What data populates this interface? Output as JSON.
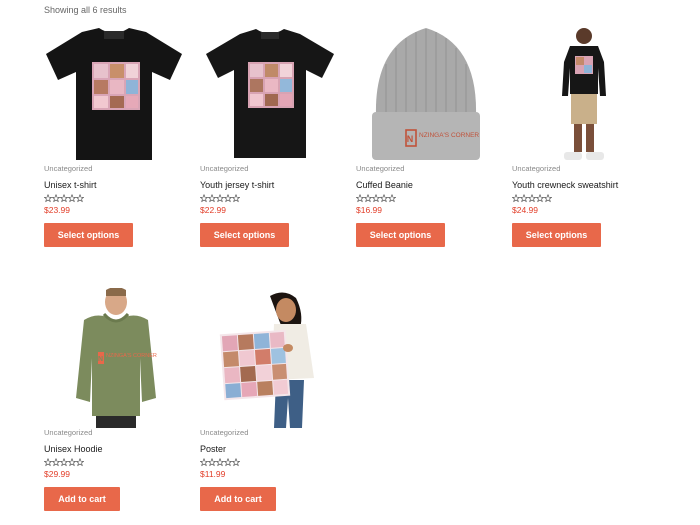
{
  "result_count": "Showing all 6 results",
  "colors": {
    "accent": "#e8684a",
    "price": "#e23d28"
  },
  "products": [
    {
      "category": "Uncategorized",
      "title": "Unisex t-shirt",
      "price": "$23.99",
      "button": "Select options",
      "rating": 0,
      "image": "black-tshirt-icon"
    },
    {
      "category": "Uncategorized",
      "title": "Youth jersey t-shirt",
      "price": "$22.99",
      "button": "Select options",
      "rating": 0,
      "image": "black-youth-tshirt-icon"
    },
    {
      "category": "Uncategorized",
      "title": "Cuffed Beanie",
      "price": "$16.99",
      "button": "Select options",
      "rating": 0,
      "image": "grey-beanie-icon",
      "logo_text": "NZINGA'S CORNER"
    },
    {
      "category": "Uncategorized",
      "title": "Youth crewneck sweatshirt",
      "price": "$24.99",
      "button": "Select options",
      "rating": 0,
      "image": "boy-sweatshirt-icon"
    },
    {
      "category": "Uncategorized",
      "title": "Unisex Hoodie",
      "price": "$29.99",
      "button": "Add to cart",
      "rating": 0,
      "image": "green-hoodie-icon",
      "logo_text": "NZINGA'S CORNER"
    },
    {
      "category": "Uncategorized",
      "title": "Poster",
      "price": "$11.99",
      "button": "Add to cart",
      "rating": 0,
      "image": "poster-icon"
    }
  ]
}
